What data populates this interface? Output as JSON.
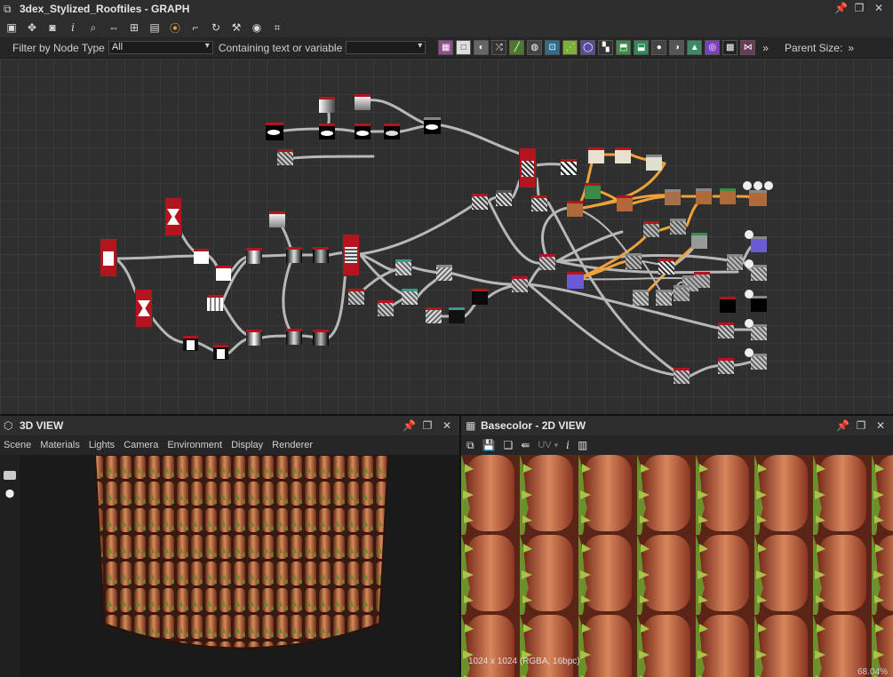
{
  "graph": {
    "title": "3dex_Stylized_Rooftiles - GRAPH",
    "filter_label": "Filter by Node Type",
    "filter_value": "All",
    "containing_label": "Containing text or variable",
    "containing_value": "",
    "parent_size_label": "Parent Size:",
    "more_glyph": "»"
  },
  "view3d": {
    "title": "3D VIEW",
    "menu": [
      "Scene",
      "Materials",
      "Lights",
      "Camera",
      "Environment",
      "Display",
      "Renderer"
    ]
  },
  "view2d": {
    "title": "Basecolor - 2D VIEW",
    "uv_label": "UV",
    "resolution": "1024 x 1024 (RGBA, 16bpc)",
    "zoom": "68.04%"
  },
  "colors": {
    "node_red": "#b3141d",
    "link_gray": "#b8b8b8",
    "link_orange": "#f0a23a",
    "accent_blue": "#5b6bd6"
  }
}
